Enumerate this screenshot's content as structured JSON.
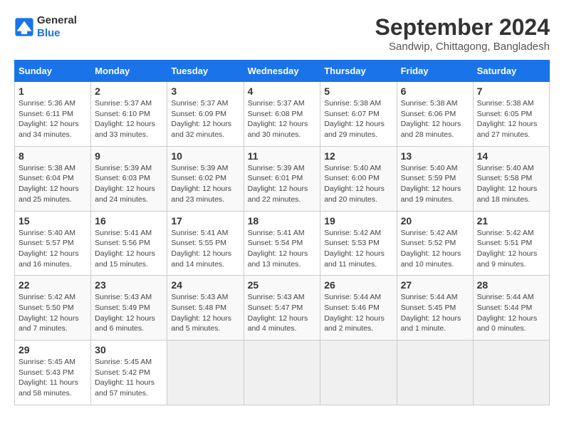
{
  "logo": {
    "line1": "General",
    "line2": "Blue"
  },
  "title": "September 2024",
  "subtitle": "Sandwip, Chittagong, Bangladesh",
  "headers": [
    "Sunday",
    "Monday",
    "Tuesday",
    "Wednesday",
    "Thursday",
    "Friday",
    "Saturday"
  ],
  "weeks": [
    [
      {
        "day": "1",
        "sunrise": "5:36 AM",
        "sunset": "6:11 PM",
        "daylight": "12 hours and 34 minutes."
      },
      {
        "day": "2",
        "sunrise": "5:37 AM",
        "sunset": "6:10 PM",
        "daylight": "12 hours and 33 minutes."
      },
      {
        "day": "3",
        "sunrise": "5:37 AM",
        "sunset": "6:09 PM",
        "daylight": "12 hours and 32 minutes."
      },
      {
        "day": "4",
        "sunrise": "5:37 AM",
        "sunset": "6:08 PM",
        "daylight": "12 hours and 30 minutes."
      },
      {
        "day": "5",
        "sunrise": "5:38 AM",
        "sunset": "6:07 PM",
        "daylight": "12 hours and 29 minutes."
      },
      {
        "day": "6",
        "sunrise": "5:38 AM",
        "sunset": "6:06 PM",
        "daylight": "12 hours and 28 minutes."
      },
      {
        "day": "7",
        "sunrise": "5:38 AM",
        "sunset": "6:05 PM",
        "daylight": "12 hours and 27 minutes."
      }
    ],
    [
      {
        "day": "8",
        "sunrise": "5:38 AM",
        "sunset": "6:04 PM",
        "daylight": "12 hours and 25 minutes."
      },
      {
        "day": "9",
        "sunrise": "5:39 AM",
        "sunset": "6:03 PM",
        "daylight": "12 hours and 24 minutes."
      },
      {
        "day": "10",
        "sunrise": "5:39 AM",
        "sunset": "6:02 PM",
        "daylight": "12 hours and 23 minutes."
      },
      {
        "day": "11",
        "sunrise": "5:39 AM",
        "sunset": "6:01 PM",
        "daylight": "12 hours and 22 minutes."
      },
      {
        "day": "12",
        "sunrise": "5:40 AM",
        "sunset": "6:00 PM",
        "daylight": "12 hours and 20 minutes."
      },
      {
        "day": "13",
        "sunrise": "5:40 AM",
        "sunset": "5:59 PM",
        "daylight": "12 hours and 19 minutes."
      },
      {
        "day": "14",
        "sunrise": "5:40 AM",
        "sunset": "5:58 PM",
        "daylight": "12 hours and 18 minutes."
      }
    ],
    [
      {
        "day": "15",
        "sunrise": "5:40 AM",
        "sunset": "5:57 PM",
        "daylight": "12 hours and 16 minutes."
      },
      {
        "day": "16",
        "sunrise": "5:41 AM",
        "sunset": "5:56 PM",
        "daylight": "12 hours and 15 minutes."
      },
      {
        "day": "17",
        "sunrise": "5:41 AM",
        "sunset": "5:55 PM",
        "daylight": "12 hours and 14 minutes."
      },
      {
        "day": "18",
        "sunrise": "5:41 AM",
        "sunset": "5:54 PM",
        "daylight": "12 hours and 13 minutes."
      },
      {
        "day": "19",
        "sunrise": "5:42 AM",
        "sunset": "5:53 PM",
        "daylight": "12 hours and 11 minutes."
      },
      {
        "day": "20",
        "sunrise": "5:42 AM",
        "sunset": "5:52 PM",
        "daylight": "12 hours and 10 minutes."
      },
      {
        "day": "21",
        "sunrise": "5:42 AM",
        "sunset": "5:51 PM",
        "daylight": "12 hours and 9 minutes."
      }
    ],
    [
      {
        "day": "22",
        "sunrise": "5:42 AM",
        "sunset": "5:50 PM",
        "daylight": "12 hours and 7 minutes."
      },
      {
        "day": "23",
        "sunrise": "5:43 AM",
        "sunset": "5:49 PM",
        "daylight": "12 hours and 6 minutes."
      },
      {
        "day": "24",
        "sunrise": "5:43 AM",
        "sunset": "5:48 PM",
        "daylight": "12 hours and 5 minutes."
      },
      {
        "day": "25",
        "sunrise": "5:43 AM",
        "sunset": "5:47 PM",
        "daylight": "12 hours and 4 minutes."
      },
      {
        "day": "26",
        "sunrise": "5:44 AM",
        "sunset": "5:46 PM",
        "daylight": "12 hours and 2 minutes."
      },
      {
        "day": "27",
        "sunrise": "5:44 AM",
        "sunset": "5:45 PM",
        "daylight": "12 hours and 1 minute."
      },
      {
        "day": "28",
        "sunrise": "5:44 AM",
        "sunset": "5:44 PM",
        "daylight": "12 hours and 0 minutes."
      }
    ],
    [
      {
        "day": "29",
        "sunrise": "5:45 AM",
        "sunset": "5:43 PM",
        "daylight": "11 hours and 58 minutes."
      },
      {
        "day": "30",
        "sunrise": "5:45 AM",
        "sunset": "5:42 PM",
        "daylight": "11 hours and 57 minutes."
      },
      null,
      null,
      null,
      null,
      null
    ]
  ],
  "labels": {
    "sunrise_prefix": "Sunrise: ",
    "sunset_prefix": "Sunset: ",
    "daylight_prefix": "Daylight: "
  }
}
